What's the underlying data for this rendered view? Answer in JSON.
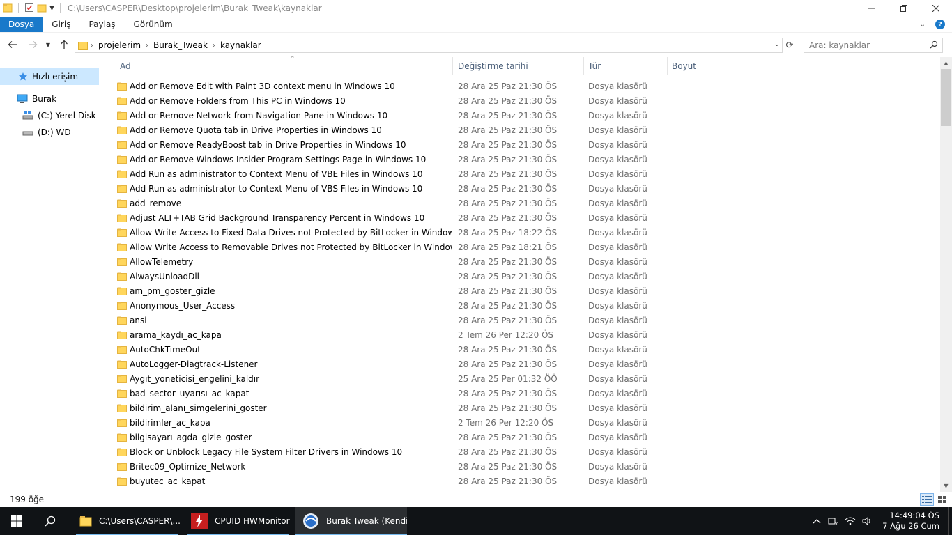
{
  "window": {
    "title_path": "C:\\Users\\CASPER\\Desktop\\projelerim\\Burak_Tweak\\kaynaklar"
  },
  "ribbon": {
    "tabs": [
      "Dosya",
      "Giriş",
      "Paylaş",
      "Görünüm"
    ],
    "active_tab": "Dosya"
  },
  "address": {
    "breadcrumbs": [
      "projelerim",
      "Burak_Tweak",
      "kaynaklar"
    ],
    "search_placeholder": "Ara: kaynaklar"
  },
  "nav": {
    "quick_access": "Hızlı erişim",
    "this_pc": "Burak",
    "drives": [
      "(C:) Yerel Disk",
      "(D:) WD"
    ]
  },
  "columns": {
    "name": "Ad",
    "date": "Değiştirme tarihi",
    "type": "Tür",
    "size": "Boyut"
  },
  "files": [
    {
      "name": "Add or Remove Edit with Paint 3D context menu in Windows 10",
      "date": "28 Ara 25 Paz 21:30 ÖS",
      "type": "Dosya klasörü"
    },
    {
      "name": "Add or Remove Folders from This PC in Windows 10",
      "date": "28 Ara 25 Paz 21:30 ÖS",
      "type": "Dosya klasörü"
    },
    {
      "name": "Add or Remove Network from Navigation Pane in Windows 10",
      "date": "28 Ara 25 Paz 21:30 ÖS",
      "type": "Dosya klasörü"
    },
    {
      "name": "Add or Remove Quota tab in Drive Properties in Windows 10",
      "date": "28 Ara 25 Paz 21:30 ÖS",
      "type": "Dosya klasörü"
    },
    {
      "name": "Add or Remove ReadyBoost tab in Drive Properties in Windows 10",
      "date": "28 Ara 25 Paz 21:30 ÖS",
      "type": "Dosya klasörü"
    },
    {
      "name": "Add or Remove Windows Insider Program Settings Page in Windows 10",
      "date": "28 Ara 25 Paz 21:30 ÖS",
      "type": "Dosya klasörü"
    },
    {
      "name": "Add Run as administrator to Context Menu of VBE Files in Windows 10",
      "date": "28 Ara 25 Paz 21:30 ÖS",
      "type": "Dosya klasörü"
    },
    {
      "name": "Add Run as administrator to Context Menu of VBS Files in Windows 10",
      "date": "28 Ara 25 Paz 21:30 ÖS",
      "type": "Dosya klasörü"
    },
    {
      "name": "add_remove",
      "date": "28 Ara 25 Paz 21:30 ÖS",
      "type": "Dosya klasörü"
    },
    {
      "name": "Adjust ALT+TAB Grid Background Transparency Percent in Windows 10",
      "date": "28 Ara 25 Paz 21:30 ÖS",
      "type": "Dosya klasörü"
    },
    {
      "name": "Allow Write Access to Fixed Data Drives not Protected by BitLocker in Windows",
      "date": "28 Ara 25 Paz 18:22 ÖS",
      "type": "Dosya klasörü"
    },
    {
      "name": "Allow Write Access to Removable Drives not Protected by BitLocker in Windows",
      "date": "28 Ara 25 Paz 18:21 ÖS",
      "type": "Dosya klasörü"
    },
    {
      "name": "AllowTelemetry",
      "date": "28 Ara 25 Paz 21:30 ÖS",
      "type": "Dosya klasörü"
    },
    {
      "name": "AlwaysUnloadDll",
      "date": "28 Ara 25 Paz 21:30 ÖS",
      "type": "Dosya klasörü"
    },
    {
      "name": "am_pm_goster_gizle",
      "date": "28 Ara 25 Paz 21:30 ÖS",
      "type": "Dosya klasörü"
    },
    {
      "name": "Anonymous_User_Access",
      "date": "28 Ara 25 Paz 21:30 ÖS",
      "type": "Dosya klasörü"
    },
    {
      "name": "ansi",
      "date": "28 Ara 25 Paz 21:30 ÖS",
      "type": "Dosya klasörü"
    },
    {
      "name": "arama_kaydı_ac_kapa",
      "date": "2 Tem 26 Per 12:20 ÖS",
      "type": "Dosya klasörü"
    },
    {
      "name": "AutoChkTimeOut",
      "date": "28 Ara 25 Paz 21:30 ÖS",
      "type": "Dosya klasörü"
    },
    {
      "name": "AutoLogger-Diagtrack-Listener",
      "date": "28 Ara 25 Paz 21:30 ÖS",
      "type": "Dosya klasörü"
    },
    {
      "name": "Aygıt_yoneticisi_engelini_kaldır",
      "date": "25 Ara 25 Per 01:32 ÖÖ",
      "type": "Dosya klasörü"
    },
    {
      "name": "bad_sector_uyarısı_ac_kapat",
      "date": "28 Ara 25 Paz 21:30 ÖS",
      "type": "Dosya klasörü"
    },
    {
      "name": "bildirim_alanı_simgelerini_goster",
      "date": "28 Ara 25 Paz 21:30 ÖS",
      "type": "Dosya klasörü"
    },
    {
      "name": "bildirimler_ac_kapa",
      "date": "2 Tem 26 Per 12:20 ÖS",
      "type": "Dosya klasörü"
    },
    {
      "name": "bilgisayarı_agda_gizle_goster",
      "date": "28 Ara 25 Paz 21:30 ÖS",
      "type": "Dosya klasörü"
    },
    {
      "name": "Block or Unblock Legacy File System Filter Drivers in Windows 10",
      "date": "28 Ara 25 Paz 21:30 ÖS",
      "type": "Dosya klasörü"
    },
    {
      "name": "Britec09_Optimize_Network",
      "date": "28 Ara 25 Paz 21:30 ÖS",
      "type": "Dosya klasörü"
    },
    {
      "name": "buyutec_ac_kapat",
      "date": "28 Ara 25 Paz 21:30 ÖS",
      "type": "Dosya klasörü"
    }
  ],
  "status": {
    "item_count": "199 öğe"
  },
  "taskbar": {
    "apps": [
      {
        "label": "C:\\Users\\CASPER\\...",
        "icon": "folder-icon"
      },
      {
        "label": "CPUID HWMonitor",
        "icon": "hwmonitor-icon"
      },
      {
        "label": "Burak Tweak (Kendi...",
        "icon": "app-icon"
      }
    ],
    "time": "14:49:04 ÖS",
    "date": "7 Ağu 26 Cum"
  },
  "colors": {
    "accent": "#1979ca",
    "folder": "#ffd65c",
    "selection": "#cce8ff",
    "taskbar": "#101316"
  }
}
